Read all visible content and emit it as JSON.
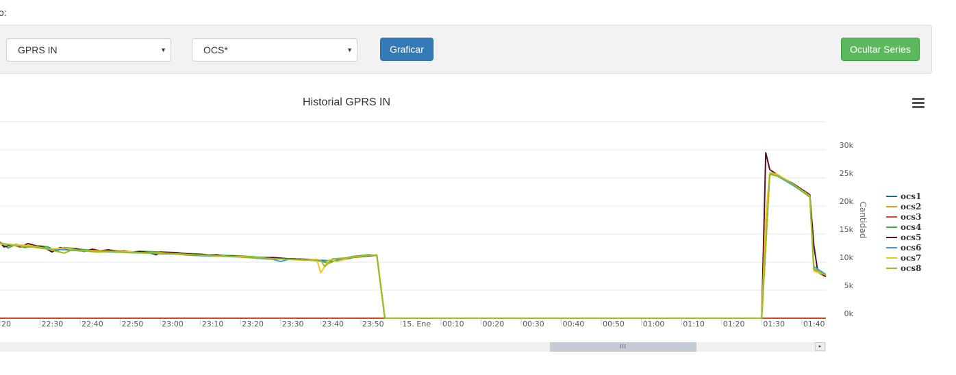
{
  "header": {
    "label": "o:"
  },
  "toolbar": {
    "metric_select": {
      "value": "GPRS IN"
    },
    "server_select": {
      "value": "OCS*"
    },
    "plot_button": "Graficar",
    "hide_series_button": "Ocultar Series"
  },
  "colors": {
    "primary": "#337ab7",
    "success": "#5cb85c"
  },
  "scrollbar": {
    "grip": "III",
    "right_arrow": "▸"
  },
  "chart_data": {
    "type": "line",
    "title": "Historial GPRS IN",
    "ylabel": "Cantidad",
    "ylim": [
      0,
      35000
    ],
    "y_ticks": [
      "0k",
      "5k",
      "10k",
      "15k",
      "20k",
      "25k",
      "30k"
    ],
    "y_tick_values": [
      0,
      5000,
      10000,
      15000,
      20000,
      25000,
      30000
    ],
    "x_ticks": [
      "20",
      "22:30",
      "22:40",
      "22:50",
      "23:00",
      "23:10",
      "23:20",
      "23:30",
      "23:40",
      "23:50",
      "15. Ene",
      "00:10",
      "00:20",
      "00:30",
      "00:40",
      "00:50",
      "01:00",
      "01:10",
      "01:20",
      "01:30",
      "01:40"
    ],
    "x_tick_minutes": [
      140,
      150,
      160,
      170,
      180,
      190,
      200,
      210,
      220,
      230,
      240,
      250,
      260,
      270,
      280,
      290,
      300,
      310,
      320,
      330,
      340
    ],
    "xlim_minutes": [
      140,
      346
    ],
    "grid": true,
    "legend": "right",
    "series": [
      {
        "name": "ocs1",
        "color": "#1a6b7a",
        "points": [
          [
            140,
            0
          ],
          [
            346,
            0
          ]
        ]
      },
      {
        "name": "ocs2",
        "color": "#f28f1c",
        "points": [
          [
            140,
            0
          ],
          [
            346,
            0
          ]
        ]
      },
      {
        "name": "ocs3",
        "color": "#d9421b",
        "points": [
          [
            140,
            0
          ],
          [
            346,
            0
          ]
        ]
      },
      {
        "name": "ocs4",
        "color": "#3bb33b",
        "points": [
          [
            140,
            13600
          ],
          [
            142,
            12500
          ],
          [
            144,
            13200
          ],
          [
            146,
            12600
          ],
          [
            150,
            12900
          ],
          [
            152,
            12700
          ],
          [
            154,
            11900
          ],
          [
            156,
            12600
          ],
          [
            160,
            12300
          ],
          [
            164,
            12000
          ],
          [
            168,
            12100
          ],
          [
            172,
            11800
          ],
          [
            176,
            11900
          ],
          [
            180,
            11800
          ],
          [
            184,
            11600
          ],
          [
            188,
            11500
          ],
          [
            192,
            11300
          ],
          [
            196,
            11200
          ],
          [
            200,
            11100
          ],
          [
            204,
            10900
          ],
          [
            208,
            10800
          ],
          [
            212,
            10600
          ],
          [
            216,
            10500
          ],
          [
            220,
            10200
          ],
          [
            222,
            9800
          ],
          [
            224,
            10400
          ],
          [
            228,
            11000
          ],
          [
            232,
            11300
          ],
          [
            234,
            11200
          ],
          [
            236,
            0
          ],
          [
            330,
            0
          ],
          [
            332,
            25800
          ],
          [
            334,
            25500
          ],
          [
            338,
            23700
          ],
          [
            342,
            21600
          ],
          [
            343,
            8600
          ],
          [
            346,
            7600
          ]
        ]
      },
      {
        "name": "ocs5",
        "color": "#5a0d25",
        "points": [
          [
            140,
            13500
          ],
          [
            141,
            12700
          ],
          [
            143,
            13100
          ],
          [
            145,
            12700
          ],
          [
            147,
            13300
          ],
          [
            149,
            12900
          ],
          [
            151,
            12600
          ],
          [
            153,
            11800
          ],
          [
            155,
            12600
          ],
          [
            157,
            12300
          ],
          [
            159,
            12400
          ],
          [
            161,
            11900
          ],
          [
            163,
            12300
          ],
          [
            165,
            12000
          ],
          [
            167,
            12200
          ],
          [
            169,
            11900
          ],
          [
            171,
            12000
          ],
          [
            173,
            11800
          ],
          [
            175,
            11900
          ],
          [
            177,
            11700
          ],
          [
            179,
            11300
          ],
          [
            180,
            11800
          ],
          [
            184,
            11700
          ],
          [
            186,
            11500
          ],
          [
            188,
            11400
          ],
          [
            190,
            11400
          ],
          [
            192,
            11200
          ],
          [
            194,
            11300
          ],
          [
            196,
            11100
          ],
          [
            198,
            11100
          ],
          [
            200,
            11000
          ],
          [
            204,
            10700
          ],
          [
            208,
            10800
          ],
          [
            212,
            10600
          ],
          [
            216,
            10500
          ],
          [
            218,
            10400
          ],
          [
            220,
            10300
          ],
          [
            224,
            10200
          ],
          [
            228,
            10800
          ],
          [
            232,
            11100
          ],
          [
            234,
            11200
          ],
          [
            236,
            0
          ],
          [
            330,
            0
          ],
          [
            331,
            29500
          ],
          [
            332,
            26500
          ],
          [
            334,
            25500
          ],
          [
            338,
            23900
          ],
          [
            342,
            22000
          ],
          [
            343,
            13000
          ],
          [
            344,
            8200
          ],
          [
            346,
            7400
          ]
        ]
      },
      {
        "name": "ocs6",
        "color": "#3a9fd8",
        "points": [
          [
            140,
            13300
          ],
          [
            144,
            13000
          ],
          [
            148,
            12800
          ],
          [
            152,
            12400
          ],
          [
            156,
            12200
          ],
          [
            160,
            12000
          ],
          [
            164,
            11900
          ],
          [
            168,
            11800
          ],
          [
            172,
            11700
          ],
          [
            176,
            11600
          ],
          [
            180,
            11500
          ],
          [
            184,
            11400
          ],
          [
            188,
            11200
          ],
          [
            192,
            11100
          ],
          [
            196,
            11000
          ],
          [
            200,
            10900
          ],
          [
            204,
            10700
          ],
          [
            208,
            10500
          ],
          [
            210,
            10100
          ],
          [
            212,
            10500
          ],
          [
            216,
            10400
          ],
          [
            220,
            10200
          ],
          [
            224,
            10300
          ],
          [
            228,
            10900
          ],
          [
            232,
            11200
          ],
          [
            234,
            11200
          ],
          [
            236,
            0
          ],
          [
            330,
            0
          ],
          [
            332,
            25700
          ],
          [
            334,
            25300
          ],
          [
            338,
            23600
          ],
          [
            342,
            21700
          ],
          [
            343,
            9200
          ],
          [
            346,
            7800
          ]
        ]
      },
      {
        "name": "ocs7",
        "color": "#f5c21b",
        "points": [
          [
            140,
            13200
          ],
          [
            144,
            13100
          ],
          [
            148,
            12900
          ],
          [
            152,
            12300
          ],
          [
            156,
            12500
          ],
          [
            160,
            12100
          ],
          [
            164,
            12000
          ],
          [
            168,
            11900
          ],
          [
            172,
            11900
          ],
          [
            176,
            11600
          ],
          [
            180,
            11700
          ],
          [
            184,
            11400
          ],
          [
            188,
            11300
          ],
          [
            192,
            11200
          ],
          [
            196,
            11000
          ],
          [
            200,
            11000
          ],
          [
            204,
            10800
          ],
          [
            208,
            10600
          ],
          [
            212,
            10500
          ],
          [
            216,
            10300
          ],
          [
            219,
            10500
          ],
          [
            220,
            8100
          ],
          [
            222,
            10400
          ],
          [
            224,
            10100
          ],
          [
            228,
            10900
          ],
          [
            232,
            11200
          ],
          [
            234,
            11300
          ],
          [
            236,
            0
          ],
          [
            330,
            0
          ],
          [
            331,
            18000
          ],
          [
            332,
            26000
          ],
          [
            334,
            25600
          ],
          [
            338,
            23800
          ],
          [
            342,
            21800
          ],
          [
            343,
            8400
          ],
          [
            346,
            7700
          ]
        ]
      },
      {
        "name": "ocs8",
        "color": "#9bbd1c",
        "points": [
          [
            140,
            13400
          ],
          [
            144,
            12900
          ],
          [
            148,
            12700
          ],
          [
            152,
            12300
          ],
          [
            156,
            11600
          ],
          [
            158,
            12200
          ],
          [
            160,
            12100
          ],
          [
            164,
            11800
          ],
          [
            168,
            11900
          ],
          [
            172,
            11700
          ],
          [
            176,
            11700
          ],
          [
            180,
            11600
          ],
          [
            184,
            11500
          ],
          [
            188,
            11300
          ],
          [
            192,
            11200
          ],
          [
            196,
            11100
          ],
          [
            200,
            10900
          ],
          [
            204,
            10800
          ],
          [
            208,
            10600
          ],
          [
            212,
            10500
          ],
          [
            216,
            10400
          ],
          [
            220,
            10300
          ],
          [
            221,
            9200
          ],
          [
            223,
            10600
          ],
          [
            228,
            10800
          ],
          [
            232,
            11200
          ],
          [
            234,
            11200
          ],
          [
            236,
            0
          ],
          [
            330,
            0
          ],
          [
            332,
            25600
          ],
          [
            334,
            25400
          ],
          [
            338,
            23800
          ],
          [
            342,
            21700
          ],
          [
            343,
            8800
          ],
          [
            346,
            7700
          ]
        ]
      }
    ]
  }
}
